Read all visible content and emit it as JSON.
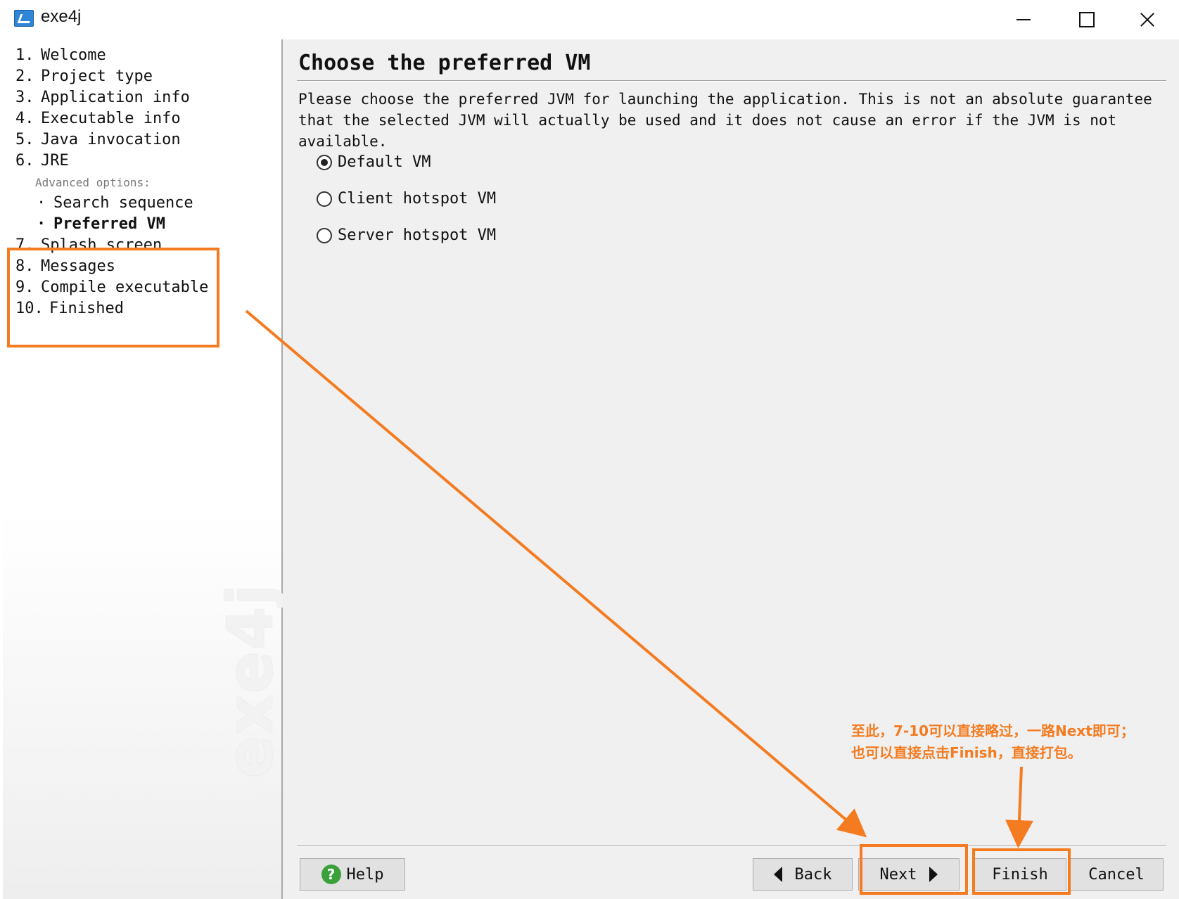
{
  "window": {
    "title": "exe4j"
  },
  "sidebar": {
    "steps_top": [
      {
        "num": "1.",
        "label": "Welcome"
      },
      {
        "num": "2.",
        "label": "Project type"
      },
      {
        "num": "3.",
        "label": "Application info"
      },
      {
        "num": "4.",
        "label": "Executable info"
      },
      {
        "num": "5.",
        "label": "Java invocation"
      },
      {
        "num": "6.",
        "label": "JRE"
      }
    ],
    "advanced_label": "Advanced options:",
    "substeps": [
      {
        "bullet": "·",
        "label": "Search sequence"
      },
      {
        "bullet": "·",
        "label": "Preferred VM"
      }
    ],
    "steps_bottom": [
      {
        "num": "7.",
        "label": "Splash screen"
      },
      {
        "num": "8.",
        "label": "Messages"
      },
      {
        "num": "9.",
        "label": "Compile executable"
      },
      {
        "num": "10.",
        "label": "Finished"
      }
    ],
    "watermark": "exe4j"
  },
  "main": {
    "title": "Choose the preferred VM",
    "description": "Please choose the preferred JVM for launching the application. This is not an absolute guarantee that the selected JVM will actually be used and it does not cause an error if the JVM is not available.",
    "options": [
      {
        "label": "Default VM",
        "checked": true
      },
      {
        "label": "Client hotspot VM",
        "checked": false
      },
      {
        "label": "Server hotspot VM",
        "checked": false
      }
    ]
  },
  "buttons": {
    "help": "Help",
    "back": "Back",
    "next": "Next",
    "finish": "Finish",
    "cancel": "Cancel"
  },
  "annotation": {
    "line1": "至此，7-10可以直接略过，一路Next即可；",
    "line2": "也可以直接点击Finish，直接打包。",
    "color": "#f47b20"
  }
}
